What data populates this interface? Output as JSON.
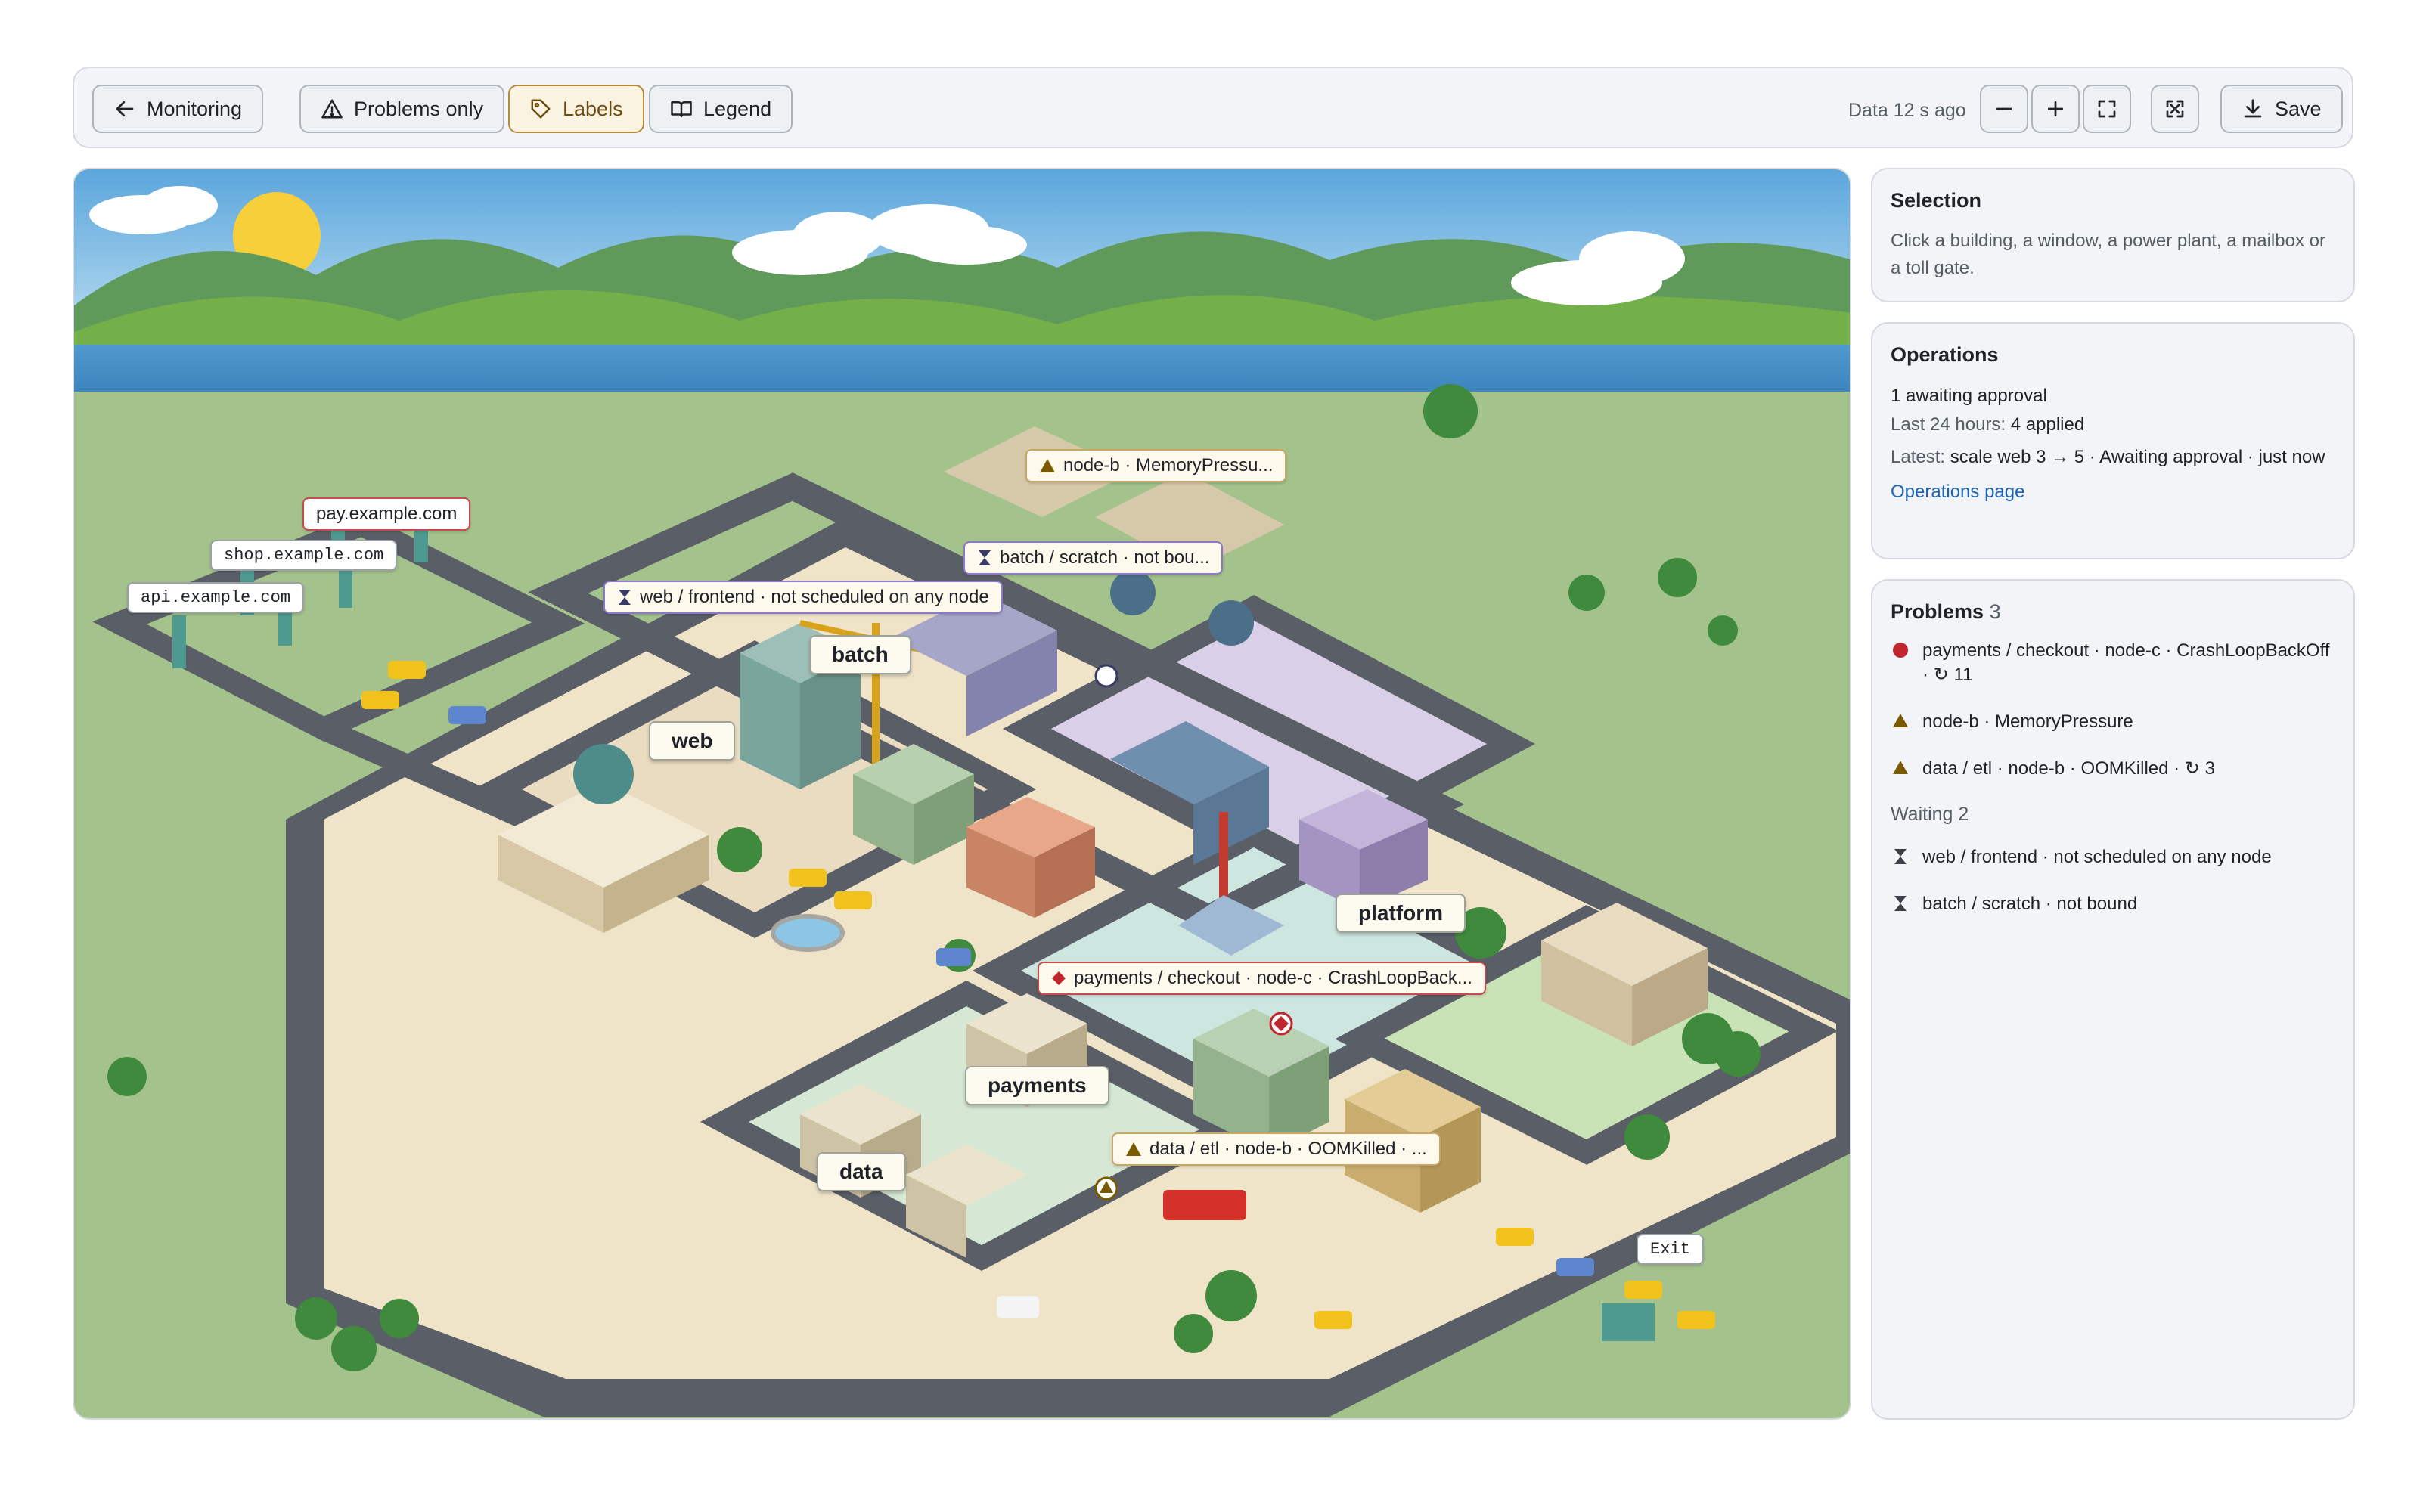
{
  "toolbar": {
    "back_label": "Monitoring",
    "problems_only_label": "Problems only",
    "labels_label": "Labels",
    "legend_label": "Legend",
    "data_age": "Data 12 s ago",
    "save_label": "Save"
  },
  "map": {
    "hosts": {
      "pay": "pay.example.com",
      "shop": "shop.example.com",
      "api": "api.example.com"
    },
    "namespaces": {
      "web": "web",
      "batch": "batch",
      "platform": "platform",
      "payments": "payments",
      "data": "data"
    },
    "callouts": {
      "memory": "node-b · MemoryPressu...",
      "batch_scratch": "batch / scratch · not bou...",
      "web_frontend": "web / frontend · not scheduled on any node",
      "checkout": "payments / checkout · node-c · CrashLoopBack...",
      "etl": "data / etl · node-b · OOMKilled · ..."
    },
    "exit_label": "Exit"
  },
  "selection": {
    "title": "Selection",
    "hint": "Click a building, a window, a power plant, a mailbox or a toll gate."
  },
  "operations": {
    "title": "Operations",
    "awaiting": "1 awaiting approval",
    "last24_prefix": "Last 24 hours:",
    "last24_value": "4 applied",
    "latest_prefix": "Latest:",
    "latest_value": "scale web 3 → 5 · Awaiting approval · just now",
    "link": "Operations page"
  },
  "problems": {
    "title": "Problems",
    "count": "3",
    "items": [
      {
        "text": "payments / checkout · node-c · CrashLoopBackOff · ↻ 11",
        "severity": "critical"
      },
      {
        "text": "node-b · MemoryPressure",
        "severity": "warning"
      },
      {
        "text": "data / etl · node-b · OOMKilled · ↻ 3",
        "severity": "warning"
      }
    ],
    "waiting_title": "Waiting",
    "waiting_count": "2",
    "waiting_items": [
      {
        "text": "web / frontend · not scheduled on any node"
      },
      {
        "text": "batch / scratch · not bound"
      }
    ]
  },
  "colors": {
    "critical": "#c0262d",
    "warning": "#7a5a00",
    "accent": "#b58b3a",
    "link": "#1a63b6"
  }
}
